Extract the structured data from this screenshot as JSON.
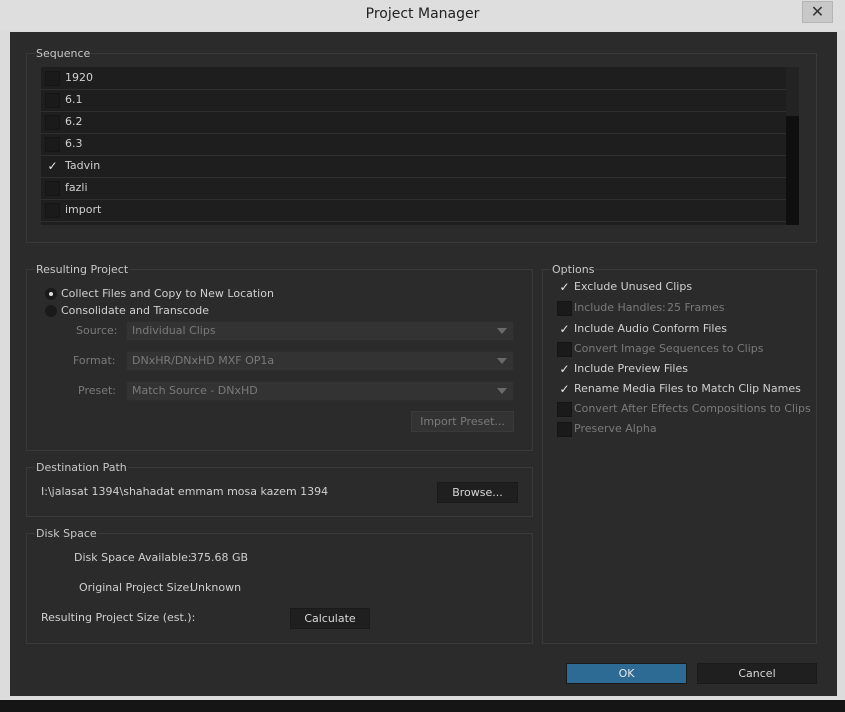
{
  "window": {
    "title": "Project Manager",
    "close_symbol": "✕"
  },
  "sequence": {
    "title": "Sequence",
    "items": [
      {
        "label": "1920",
        "checked": false
      },
      {
        "label": "6.1",
        "checked": false
      },
      {
        "label": "6.2",
        "checked": false
      },
      {
        "label": "6.3",
        "checked": false
      },
      {
        "label": "Tadvin",
        "checked": true
      },
      {
        "label": "fazli",
        "checked": false
      },
      {
        "label": "import",
        "checked": false
      }
    ]
  },
  "resulting_project": {
    "title": "Resulting Project",
    "collect_label": "Collect Files and Copy to New Location",
    "consolidate_label": "Consolidate and Transcode",
    "source_label": "Source:",
    "source_value": "Individual Clips",
    "format_label": "Format:",
    "format_value": "DNxHR/DNxHD MXF OP1a",
    "preset_label": "Preset:",
    "preset_value": "Match Source - DNxHD",
    "import_preset": "Import Preset..."
  },
  "options": {
    "title": "Options",
    "exclude_unused": "Exclude Unused Clips",
    "include_handles": "Include Handles:",
    "handles_value": "25 Frames",
    "include_audio_conform": "Include Audio Conform Files",
    "convert_image_sequences": "Convert Image Sequences to Clips",
    "include_preview": "Include Preview Files",
    "rename_media": "Rename Media Files to Match Clip Names",
    "convert_after_effects": "Convert After Effects Compositions to Clips",
    "preserve_alpha": "Preserve Alpha",
    "check_glyph": "✓"
  },
  "destination": {
    "title": "Destination Path",
    "path": "I:\\jalasat 1394\\shahadat emmam mosa kazem 1394",
    "browse": "Browse..."
  },
  "disk_space": {
    "title": "Disk Space",
    "available_label": "Disk Space Available:",
    "available_value": "375.68 GB",
    "original_label": "Original Project Size:",
    "original_value": "Unknown",
    "resulting_label": "Resulting Project Size (est.):",
    "calculate": "Calculate"
  },
  "footer": {
    "ok": "OK",
    "cancel": "Cancel"
  },
  "colors": {
    "accent": "#2d6a94",
    "panel": "#2b2b2b",
    "titlebar": "#dedede"
  }
}
